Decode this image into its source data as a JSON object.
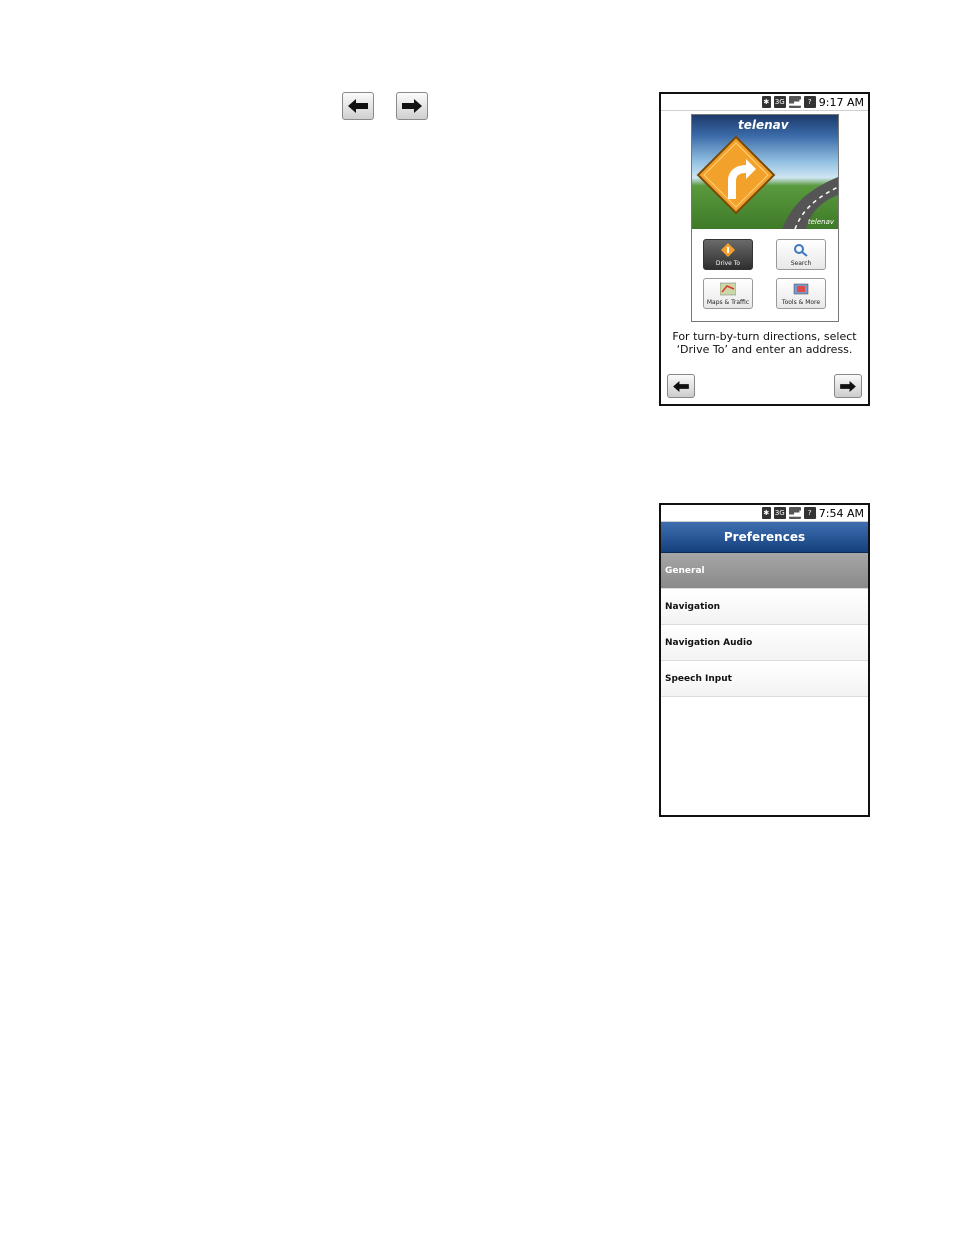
{
  "top_nav": {
    "back_icon": "left-arrow-icon",
    "next_icon": "right-arrow-icon"
  },
  "screen1": {
    "status": {
      "time": "9:17 AM",
      "icons": [
        "bluetooth-icon",
        "3g-icon",
        "signal-icon",
        "sim-unknown-icon"
      ]
    },
    "brand": "telenav",
    "powered_by": "telenav",
    "tiles": [
      {
        "label": "Drive To",
        "icon": "drive-to-icon",
        "selected": true
      },
      {
        "label": "Search",
        "icon": "search-icon",
        "selected": false
      },
      {
        "label": "Maps & Traffic",
        "icon": "maps-traffic-icon",
        "selected": false
      },
      {
        "label": "Tools & More",
        "icon": "tools-more-icon",
        "selected": false
      }
    ],
    "caption_line1": "For turn-by-turn directions, select",
    "caption_line2": "‘Drive To’ and enter an address."
  },
  "screen2": {
    "status": {
      "time": "7:54 AM",
      "icons": [
        "bluetooth-icon",
        "3g-icon",
        "signal-icon",
        "sim-unknown-icon"
      ]
    },
    "title": "Preferences",
    "items": [
      {
        "label": "General",
        "selected": true
      },
      {
        "label": "Navigation",
        "selected": false
      },
      {
        "label": "Navigation Audio",
        "selected": false
      },
      {
        "label": "Speech Input",
        "selected": false
      }
    ]
  },
  "colors": {
    "header_blue": "#1f4a8a",
    "selected_gray": "#8e8e8e",
    "sign_orange": "#f2a12a"
  }
}
